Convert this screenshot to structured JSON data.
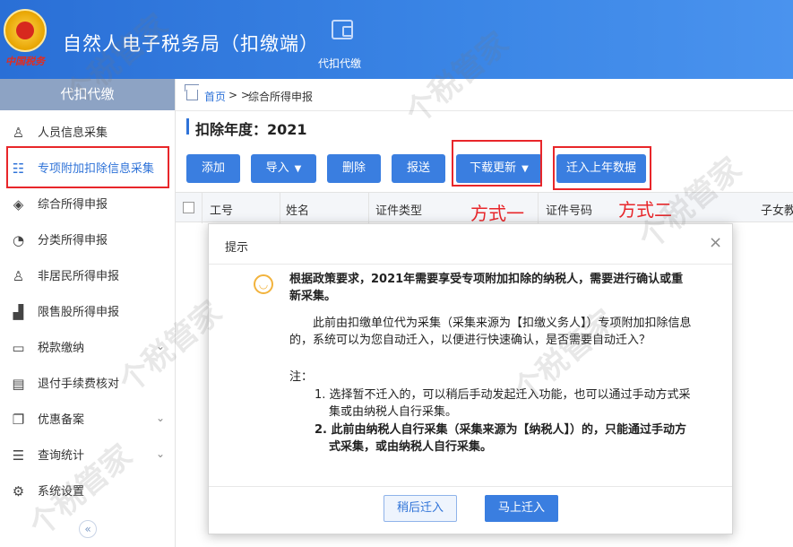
{
  "header": {
    "emblem_text": "中国税务",
    "app_title": "自然人电子税务局（扣缴端）",
    "module_label": "代扣代缴"
  },
  "sidebar": {
    "title": "代扣代缴",
    "items": [
      {
        "label": "人员信息采集",
        "icon": "person-icon"
      },
      {
        "label": "专项附加扣除信息采集",
        "icon": "list-grid-icon"
      },
      {
        "label": "综合所得申报",
        "icon": "layers-icon"
      },
      {
        "label": "分类所得申报",
        "icon": "pie-chart-icon"
      },
      {
        "label": "非居民所得申报",
        "icon": "user-outline-icon"
      },
      {
        "label": "限售股所得申报",
        "icon": "bar-chart-icon"
      },
      {
        "label": "税款缴纳",
        "icon": "wallet-icon"
      },
      {
        "label": "退付手续费核对",
        "icon": "document-check-icon"
      },
      {
        "label": "优惠备案",
        "icon": "copy-icon"
      },
      {
        "label": "查询统计",
        "icon": "search-list-icon"
      },
      {
        "label": "系统设置",
        "icon": "gear-icon"
      }
    ],
    "collapse": "«"
  },
  "breadcrumb": {
    "home": "首页",
    "separator": "> >",
    "current": "综合所得申报"
  },
  "year_label": "扣除年度：2021",
  "toolbar": {
    "add": "添加",
    "import": "导入",
    "delete": "删除",
    "submit": "报送",
    "download_update": "下载更新",
    "migrate_last_year": "迁入上年数据"
  },
  "annotations": {
    "method_one": "方式一",
    "method_two": "方式二"
  },
  "table": {
    "columns": [
      "工号",
      "姓名",
      "证件类型",
      "证件号码",
      "子女教"
    ]
  },
  "dialog": {
    "title": "提示",
    "close": "×",
    "heading": "根据政策要求，2021年需要享受专项附加扣除的纳税人，需要进行确认或重新采集。",
    "paragraph": "此前由扣缴单位代为采集（采集来源为【扣缴义务人】）专项附加扣除信息的，系统可以为您自动迁入，以便进行快速确认，是否需要自动迁入？",
    "note_label": "注：",
    "note1": "1. 选择暂不迁入的，可以稍后手动发起迁入功能，也可以通过手动方式采集或由纳税人自行采集。",
    "note2": "2. 此前由纳税人自行采集（采集来源为【纳税人】）的，只能通过手动方式采集，或由纳税人自行采集。",
    "btn_later": "稍后迁入",
    "btn_now": "马上迁入"
  },
  "watermark": "个税管家",
  "colors": {
    "header_blue": "#2a6fd6",
    "primary_button": "#3a7ee0",
    "highlight_red": "#e8262a",
    "sidebar_title_bg": "#8da3c4"
  }
}
